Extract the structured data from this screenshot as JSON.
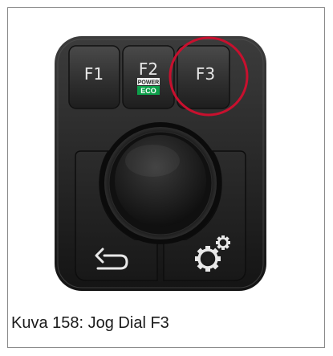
{
  "keys": {
    "f1_label": "F1",
    "f2_label": "F2",
    "f2_badge_top": "POWER",
    "f2_badge_bottom": "ECO",
    "f3_label": "F3"
  },
  "icons": {
    "back": "back-arrow-icon",
    "settings": "gear-icon"
  },
  "colors": {
    "highlight_ring": "#c8102e",
    "eco_badge": "#0ea04b",
    "key_text": "#e8e8e8"
  },
  "caption": "Kuva 158: Jog Dial F3"
}
